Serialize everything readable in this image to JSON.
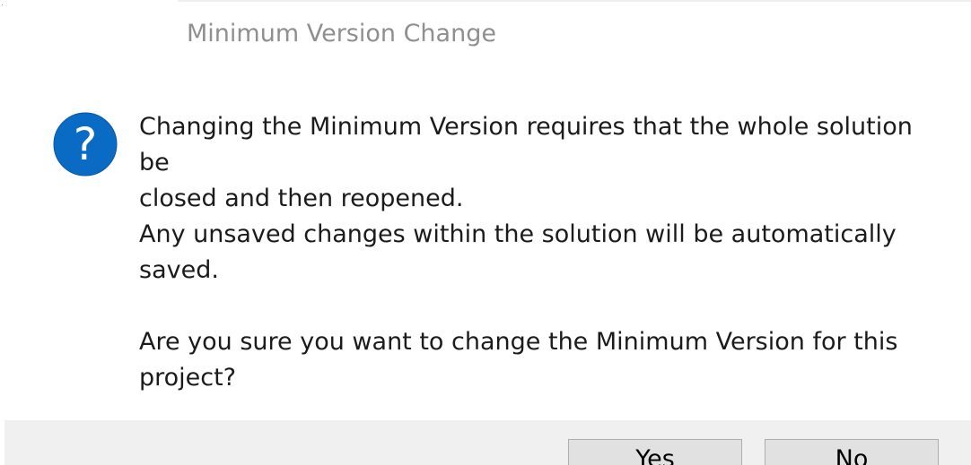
{
  "dialog": {
    "title": "Minimum Version Change",
    "icon": "question-icon",
    "icon_color": "#0a6bc4",
    "icon_glyph": "?",
    "message": {
      "line1": "Changing the Minimum Version requires that the whole solution be",
      "line2": "closed and then reopened.",
      "line3": "Any unsaved changes within the solution will be automatically",
      "line4": "saved.",
      "line5": "Are you sure you want to change the Minimum Version for this",
      "line6": "project?"
    },
    "buttons": {
      "yes_label": "Yes",
      "no_label": "No"
    }
  }
}
